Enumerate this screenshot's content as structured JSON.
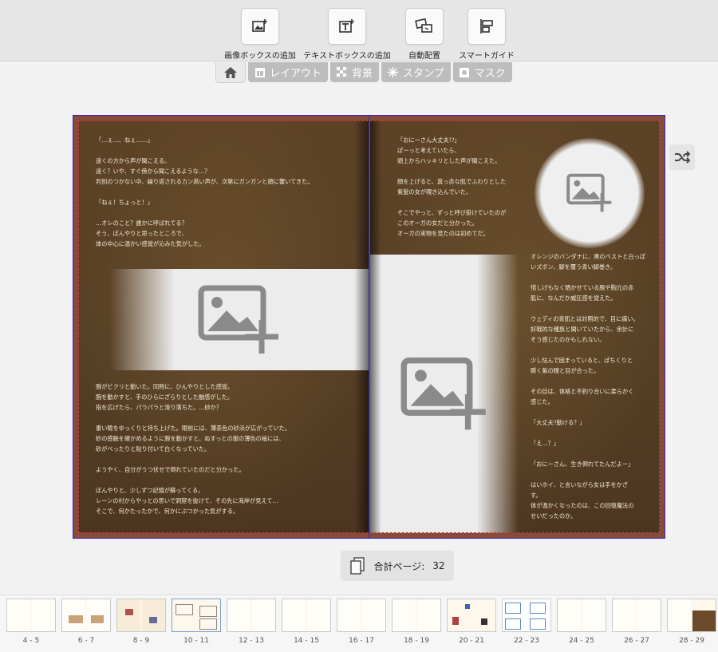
{
  "toolbar": {
    "tools": [
      {
        "label": "画像ボックスの追加",
        "icon": "add-image-icon"
      },
      {
        "label": "テキストボックスの追加",
        "icon": "add-text-icon"
      },
      {
        "label": "自動配置",
        "icon": "auto-layout-icon"
      },
      {
        "label": "スマートガイド",
        "icon": "smart-guide-icon"
      }
    ]
  },
  "tabs": [
    {
      "label": "",
      "icon": "home-icon"
    },
    {
      "label": "レイアウト",
      "icon": "layout-icon"
    },
    {
      "label": "背景",
      "icon": "background-icon"
    },
    {
      "label": "スタンプ",
      "icon": "stamp-icon"
    },
    {
      "label": "マスク",
      "icon": "mask-icon"
    }
  ],
  "left_page": {
    "text_top": "「…ぇ…、ねぇ……」\n\n遠くの方から声が聞こえる。\n遠く？いや、すぐ傍から聞こえるような…？\n判別のつかない中、繰り返されるカン高い声が、次第にガンガンと頭に響いてきた。\n\n「ねぇ！ちょっと！」\n\n…オレのこと？誰かに呼ばれてる？\nそう、ぼんやりと思ったところで、\n体の中心に温かい感覚が沁みた気がした。",
    "text_bottom": "腕がビクリと動いた。同時に、ひんやりとした感覚。\n腕を動かすと、手のひらにざらりとした触感がした。\n指を広げたら、パラパラと滑り落ちた。…砂か？\n\n重い瞼をゆっくりと持ち上げた。眼前には、薄茶色の砂浜が広がっていた。\n砂の感触を確かめるように腕を動かすと、ぬすっとの服の薄色の袖には、\n砂がべったりと貼り付いて白くなっていた。\n\nようやく、自分がうつ伏せで倒れていたのだと分かった。\n\nぼんやりと、少しずつ記憶が蘇ってくる。\nレーンの村からやっとの思いで洞窟を抜けて、その先に海岸が見えて…\nそこで、何かたったかで、何かにぶつかった気がする。"
  },
  "right_page": {
    "text_top": "「おにーさん大丈夫!?」\nぱーっと考えていたら、\n頭上からハッキリとした声が聞こえた。\n\n顔を上げると、真っ赤な肌でふわりとした\n紫髪の女が覗き込んでいた。\n\nそこでやっと、ずっと呼び掛けていたのが\nこのオーガの女だと分かった。\nオーガの実物を見たのは初めてだ。",
    "text_right": "オレンジのバンダナに、黒のベストと白っぽ\nいズボン、脚を覆う青い脚巻き。\n\n惜しげもなく晒かせている腕や胸元の赤\n肌に、なんだか威圧感を覚えた。\n\nウェディの青肌とは対照的で、目に痛い。\n好戦的な種族と聞いていたから、余計に\nそう感じたのかもしれない。\n\n少し怯んで固まっていると、ぱちくりと\n瞬く紫の瞳と目が合った。\n\nその目は、体格と不釣り合いに柔らかく\n感じた。\n\n「大丈夫?動ける？」\n\n「え…？」\n\n「おにーさん、生き倒れてたんだよー」\n\nはいホイ、と言いながら女は手をかざ\nす。\n体が温かくなったのは、この回復魔法の\nせいだったのか。"
  },
  "total_pages": {
    "label": "合計ページ:",
    "value": "32"
  },
  "thumbnails": [
    "4 - 5",
    "6 - 7",
    "8 - 9",
    "10 - 11",
    "12 - 13",
    "14 - 15",
    "16 - 17",
    "18 - 19",
    "20 - 21",
    "22 - 23",
    "24 - 25",
    "26 - 27",
    "28 - 29"
  ],
  "colors": {
    "accent_border": "#2a2ac8",
    "bleed_line": "#c23a3a",
    "page_bg": "#5c4124"
  }
}
